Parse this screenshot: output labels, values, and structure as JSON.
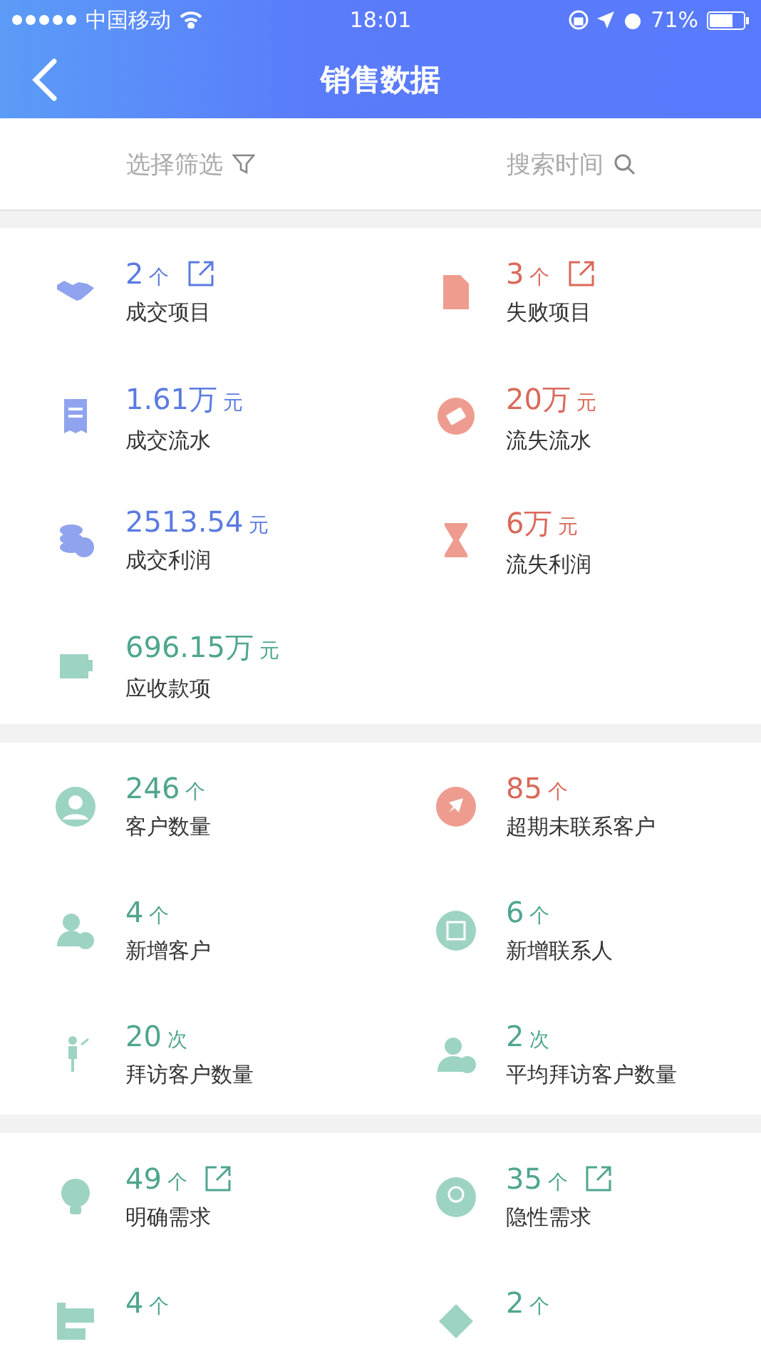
{
  "status_bar": {
    "carrier": "中国移动",
    "time": "18:01",
    "battery": "71%"
  },
  "nav": {
    "title": "销售数据"
  },
  "filters": [
    {
      "label": "选择筛选",
      "kind": "filter"
    },
    {
      "label": "搜索时间",
      "kind": "search"
    }
  ],
  "sections": [
    {
      "items": [
        {
          "value": "2",
          "unit": "个",
          "label": "成交项目",
          "color": "#5b7be0",
          "link": true
        },
        {
          "value": "3",
          "unit": "个",
          "label": "失败项目",
          "color": "#d9695a",
          "link": true
        },
        {
          "value": "1.61万",
          "unit": "元",
          "label": "成交流水",
          "color": "#5b7be0",
          "link": false
        },
        {
          "value": "20万",
          "unit": "元",
          "label": "流失流水",
          "color": "#d9695a",
          "link": false
        },
        {
          "value": "2513.54",
          "unit": "元",
          "label": "成交利润",
          "color": "#5b7be0",
          "link": false
        },
        {
          "value": "6万",
          "unit": "元",
          "label": "流失利润",
          "color": "#d9695a",
          "link": false
        },
        {
          "value": "696.15万",
          "unit": "元",
          "label": "应收款项",
          "color": "#4fa58f",
          "link": false
        }
      ]
    },
    {
      "items": [
        {
          "value": "246",
          "unit": "个",
          "label": "客户数量",
          "color": "#4fa58f",
          "link": false
        },
        {
          "value": "85",
          "unit": "个",
          "label": "超期未联系客户",
          "color": "#d9695a",
          "link": false
        },
        {
          "value": "4",
          "unit": "个",
          "label": "新增客户",
          "color": "#4fa58f",
          "link": false
        },
        {
          "value": "6",
          "unit": "个",
          "label": "新增联系人",
          "color": "#4fa58f",
          "link": false
        },
        {
          "value": "20",
          "unit": "次",
          "label": "拜访客户数量",
          "color": "#4fa58f",
          "link": false
        },
        {
          "value": "2",
          "unit": "次",
          "label": "平均拜访客户数量",
          "color": "#4fa58f",
          "link": false
        }
      ]
    },
    {
      "items": [
        {
          "value": "49",
          "unit": "个",
          "label": "明确需求",
          "color": "#4fa58f",
          "link": true
        },
        {
          "value": "35",
          "unit": "个",
          "label": "隐性需求",
          "color": "#4fa58f",
          "link": true
        },
        {
          "value": "4",
          "unit": "个",
          "color": "#4fa58f",
          "link": false
        },
        {
          "value": "2",
          "unit": "个",
          "color": "#4fa58f",
          "link": false
        }
      ]
    }
  ]
}
